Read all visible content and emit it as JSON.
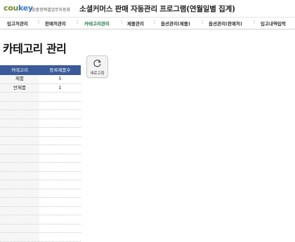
{
  "brand": {
    "logo_part1": "cou",
    "logo_part2": "key",
    "subtitle": "맞춤형엑셀업무자동화"
  },
  "app_title": "소셜커머스 판매 자동관리 프로그램(연월일별 집계)",
  "nav": {
    "items": [
      {
        "label": "입고처관리",
        "active": false
      },
      {
        "label": "판매처관리",
        "active": false
      },
      {
        "label": "카테고리관리",
        "active": true
      },
      {
        "label": "제품관리",
        "active": false
      },
      {
        "label": "옵션관리(제품)",
        "active": false
      },
      {
        "label": "옵션관리(판매처)",
        "active": false
      },
      {
        "label": "입고내역입력",
        "active": false
      }
    ],
    "separator": "|"
  },
  "page_title": "카테고리 관리",
  "refresh_button": {
    "label": "새로고침",
    "icon": "refresh-icon"
  },
  "table": {
    "headers": [
      "카테고리",
      "등록제품수"
    ],
    "rows": [
      [
        "제품",
        "5"
      ],
      [
        "반제품",
        "1"
      ]
    ]
  },
  "colors": {
    "header_bg": "#3b5a99",
    "active_nav": "#1f7a3b",
    "logo_green": "#6c8a2a",
    "logo_blue": "#3b79c8"
  }
}
